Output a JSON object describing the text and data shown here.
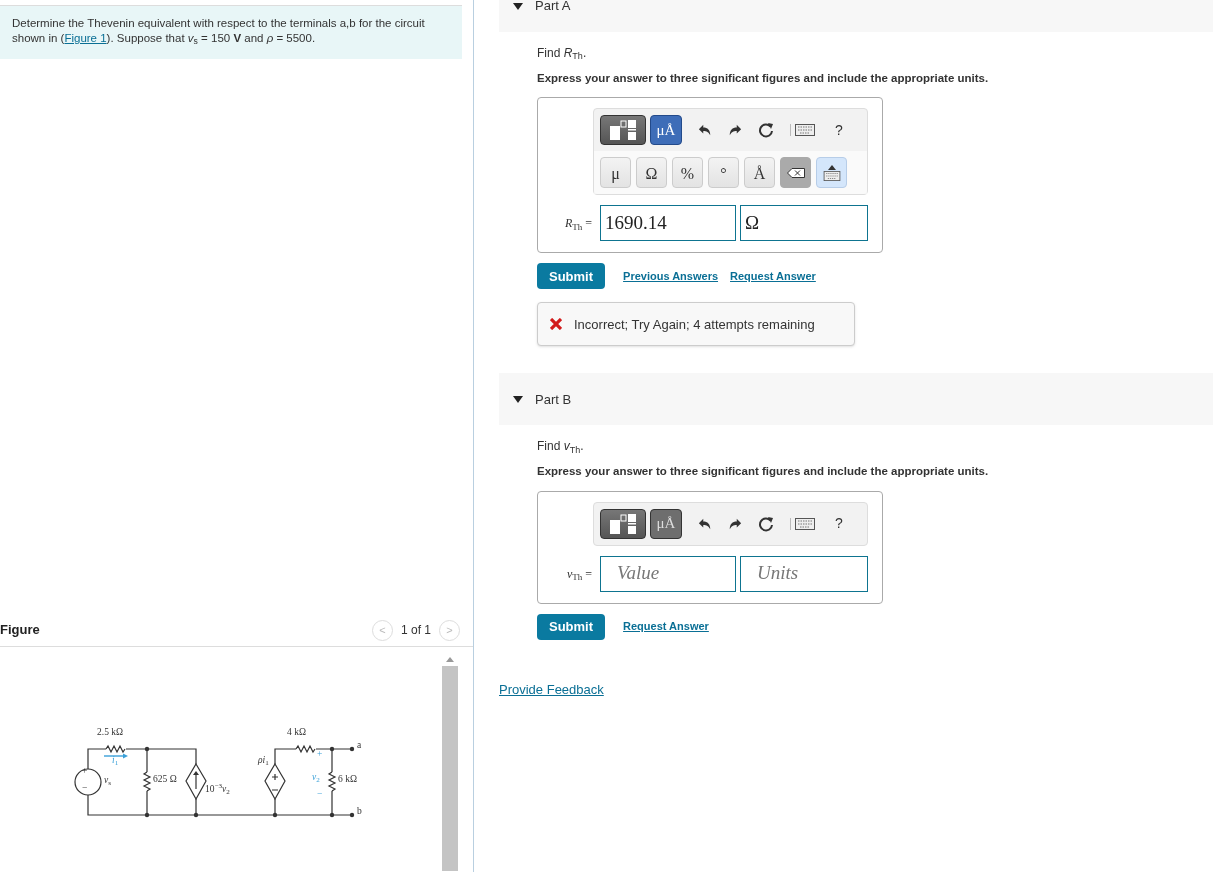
{
  "intro": {
    "before": "Determine the Thevenin equivalent with respect to the terminals a,b for the circuit shown in (",
    "link": "Figure 1",
    "after": "). Suppose that *v*$_{s}$ = 150 **V** and *ρ* = 5500."
  },
  "figure": {
    "title": "Figure",
    "pager": "1 of 1",
    "prev": "<",
    "next": ">",
    "labels": [
      "2.5 kΩ",
      "*i*$_{1}$",
      "*v*$_{s}$",
      "625 Ω",
      "10$^{−3}$*v*$_{2}$",
      "*ρi*$_{1}$",
      "4 kΩ",
      "+",
      "*v*$_{2}$",
      "−",
      "6 kΩ",
      "a",
      "b",
      "+",
      "−"
    ]
  },
  "parts": [
    {
      "title": "Part A",
      "expanded": true,
      "prompt": "Find *R*$_{Th}$.",
      "instruction": "Express your answer to three significant figures and include the appropriate units.",
      "toolbar": {
        "units_selected": true,
        "units_label": "μÅ",
        "help": "?",
        "symbols": [
          "μ",
          "Ω",
          "%",
          "°",
          "Å"
        ]
      },
      "label": "*R*$_{Th}$ =",
      "value": "1690.14",
      "units": "Ω",
      "submit": "Submit",
      "links": [
        "Previous Answers",
        "Request Answer"
      ],
      "feedback": {
        "kind": "error",
        "text": "Incorrect; Try Again; 4 attempts remaining"
      }
    },
    {
      "title": "Part B",
      "expanded": true,
      "prompt": "Find *v*$_{Th}$.",
      "instruction": "Express your answer to three significant figures and include the appropriate units.",
      "toolbar": {
        "units_selected": false,
        "units_label": "μÅ",
        "help": "?"
      },
      "label": "*v*$_{Th}$ =",
      "value_placeholder": "Value",
      "units_placeholder": "Units",
      "submit": "Submit",
      "links": [
        "Request Answer"
      ]
    }
  ],
  "provide_feedback": "Provide Feedback"
}
